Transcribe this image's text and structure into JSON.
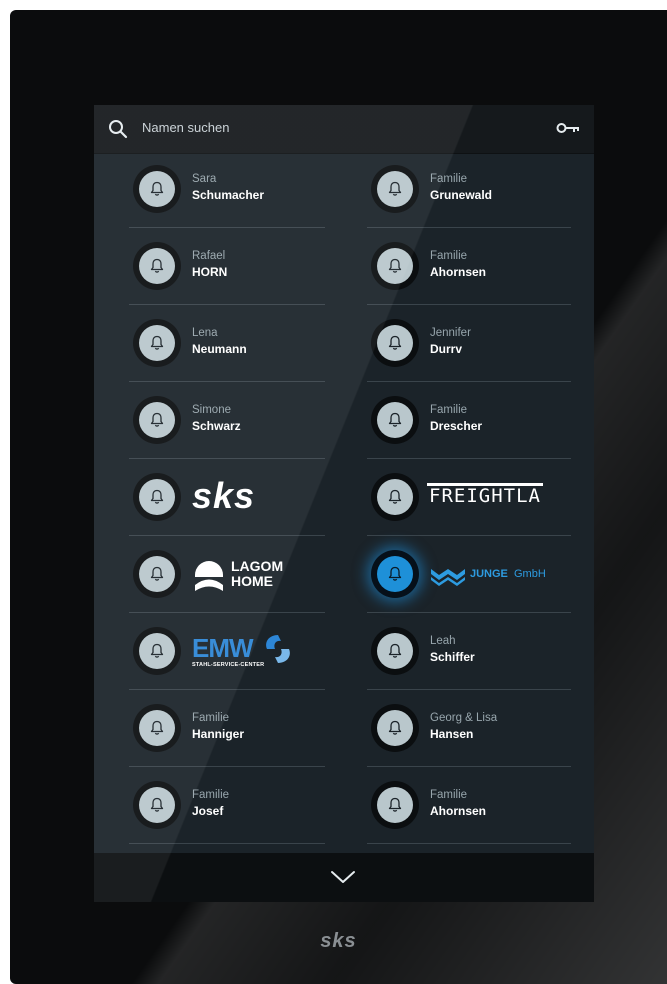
{
  "search": {
    "placeholder": "Namen suchen"
  },
  "icons": {
    "search": "search-icon",
    "key": "key-icon",
    "bell": "bell-icon",
    "more": "chevron-down-icon"
  },
  "colors": {
    "active_bell": "#1e90d8",
    "bell": "#b9c7cc",
    "panel": "#1b2329"
  },
  "left_column": [
    {
      "first": "Sara",
      "last": "Schumacher"
    },
    {
      "first": "Rafael",
      "last": "HORN"
    },
    {
      "first": "Lena",
      "last": "Neumann"
    },
    {
      "first": "Simone",
      "last": "Schwarz"
    },
    {
      "logo": "sks"
    },
    {
      "logo": "LAGOM HOME"
    },
    {
      "logo": "EMW",
      "logo_sub": "STAHL-SERVICE-CENTER"
    },
    {
      "first": "Familie",
      "last": "Hanniger"
    },
    {
      "first": "Familie",
      "last": "Josef"
    }
  ],
  "right_column": [
    {
      "first": "Familie",
      "last": "Grunewald"
    },
    {
      "first": "Familie",
      "last": "Ahornsen"
    },
    {
      "first": "Jennifer",
      "last": "Durrv"
    },
    {
      "first": "Familie",
      "last": "Drescher"
    },
    {
      "logo": "FREIGHTLA"
    },
    {
      "logo": "JUNGE GmbH",
      "logo_bold": "JUNGE",
      "logo_light": "GmbH",
      "active": true
    },
    {
      "first": "Leah",
      "last": "Schiffer"
    },
    {
      "first": "Georg & Lisa",
      "last": "Hansen"
    },
    {
      "first": "Familie",
      "last": "Ahornsen"
    }
  ],
  "logos": {
    "sks": "sks",
    "lagom_line1": "LAGOM",
    "lagom_line2": "HOME",
    "emw": "EMW",
    "emw_sub": "STAHL-SERVICE-CENTER",
    "freight": "FREIGHTLA",
    "junge_bold": "JUNGE",
    "junge_light": "GmbH"
  },
  "device": {
    "brand": "sks"
  }
}
